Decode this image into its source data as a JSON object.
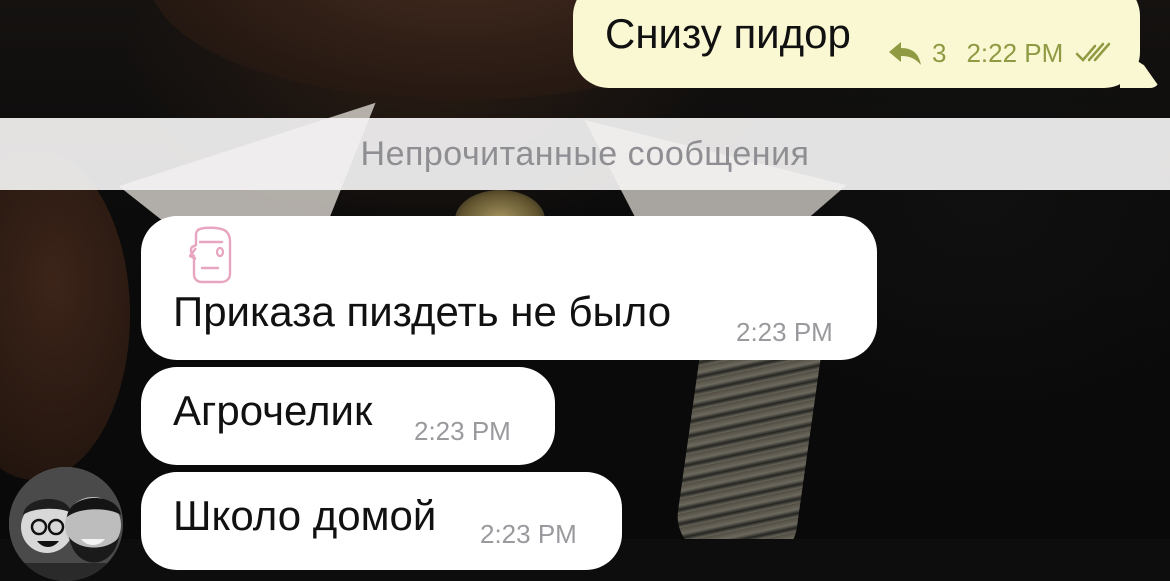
{
  "chat": {
    "outgoing": {
      "text": "Снизу пидор",
      "reply_count": "3",
      "time": "2:22 PM",
      "icons": {
        "reply": "reply-icon",
        "status": "double-check-icon"
      },
      "colors": {
        "bubble": "#f9f8d2",
        "meta": "#8f9a43"
      }
    },
    "unread_divider": "Непрочитанные сообщения",
    "incoming": [
      {
        "text": "Приказа пиздеть не было",
        "time": "2:23 PM",
        "icon": "moai-sticker-icon"
      },
      {
        "text": "Агрочелик",
        "time": "2:23 PM"
      },
      {
        "text": "Школо домой",
        "time": "2:23 PM"
      }
    ],
    "sender_avatar": "avatar",
    "colors": {
      "incoming_bubble": "#ffffff",
      "time": "#9a9a9e",
      "divider_bg": "#f3f2f2",
      "divider_text": "#8f8f93"
    }
  }
}
